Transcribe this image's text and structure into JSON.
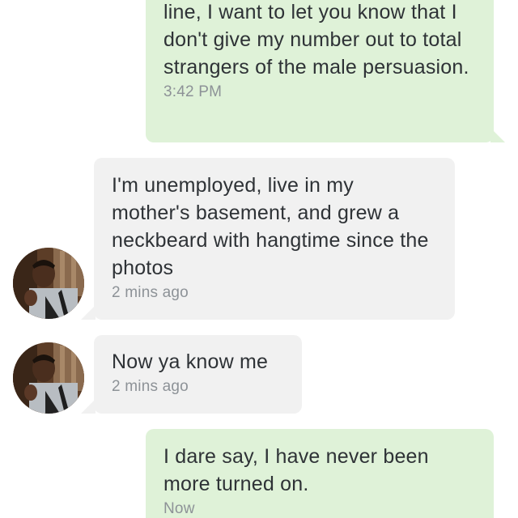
{
  "messages": [
    {
      "direction": "outgoing",
      "text": "line, I want to let you know that I don't give my number out to total strangers of the male persuasion.",
      "time": "3:42 PM"
    },
    {
      "direction": "incoming",
      "text": "I'm unemployed, live in my mother's basement, and grew a neckbeard with hangtime since the photos",
      "time": "2 mins ago",
      "avatar_icon": "user-avatar-icon"
    },
    {
      "direction": "incoming",
      "text": "Now ya know me",
      "time": "2 mins ago",
      "avatar_icon": "user-avatar-icon"
    },
    {
      "direction": "outgoing",
      "text": "I dare say, I have never been more turned on.",
      "time": "Now"
    }
  ],
  "colors": {
    "outgoing_bubble": "#dff2d8",
    "incoming_bubble": "#f1f1f1",
    "message_text": "#2e3236",
    "timestamp_text": "#8d9297",
    "background": "#ffffff"
  }
}
